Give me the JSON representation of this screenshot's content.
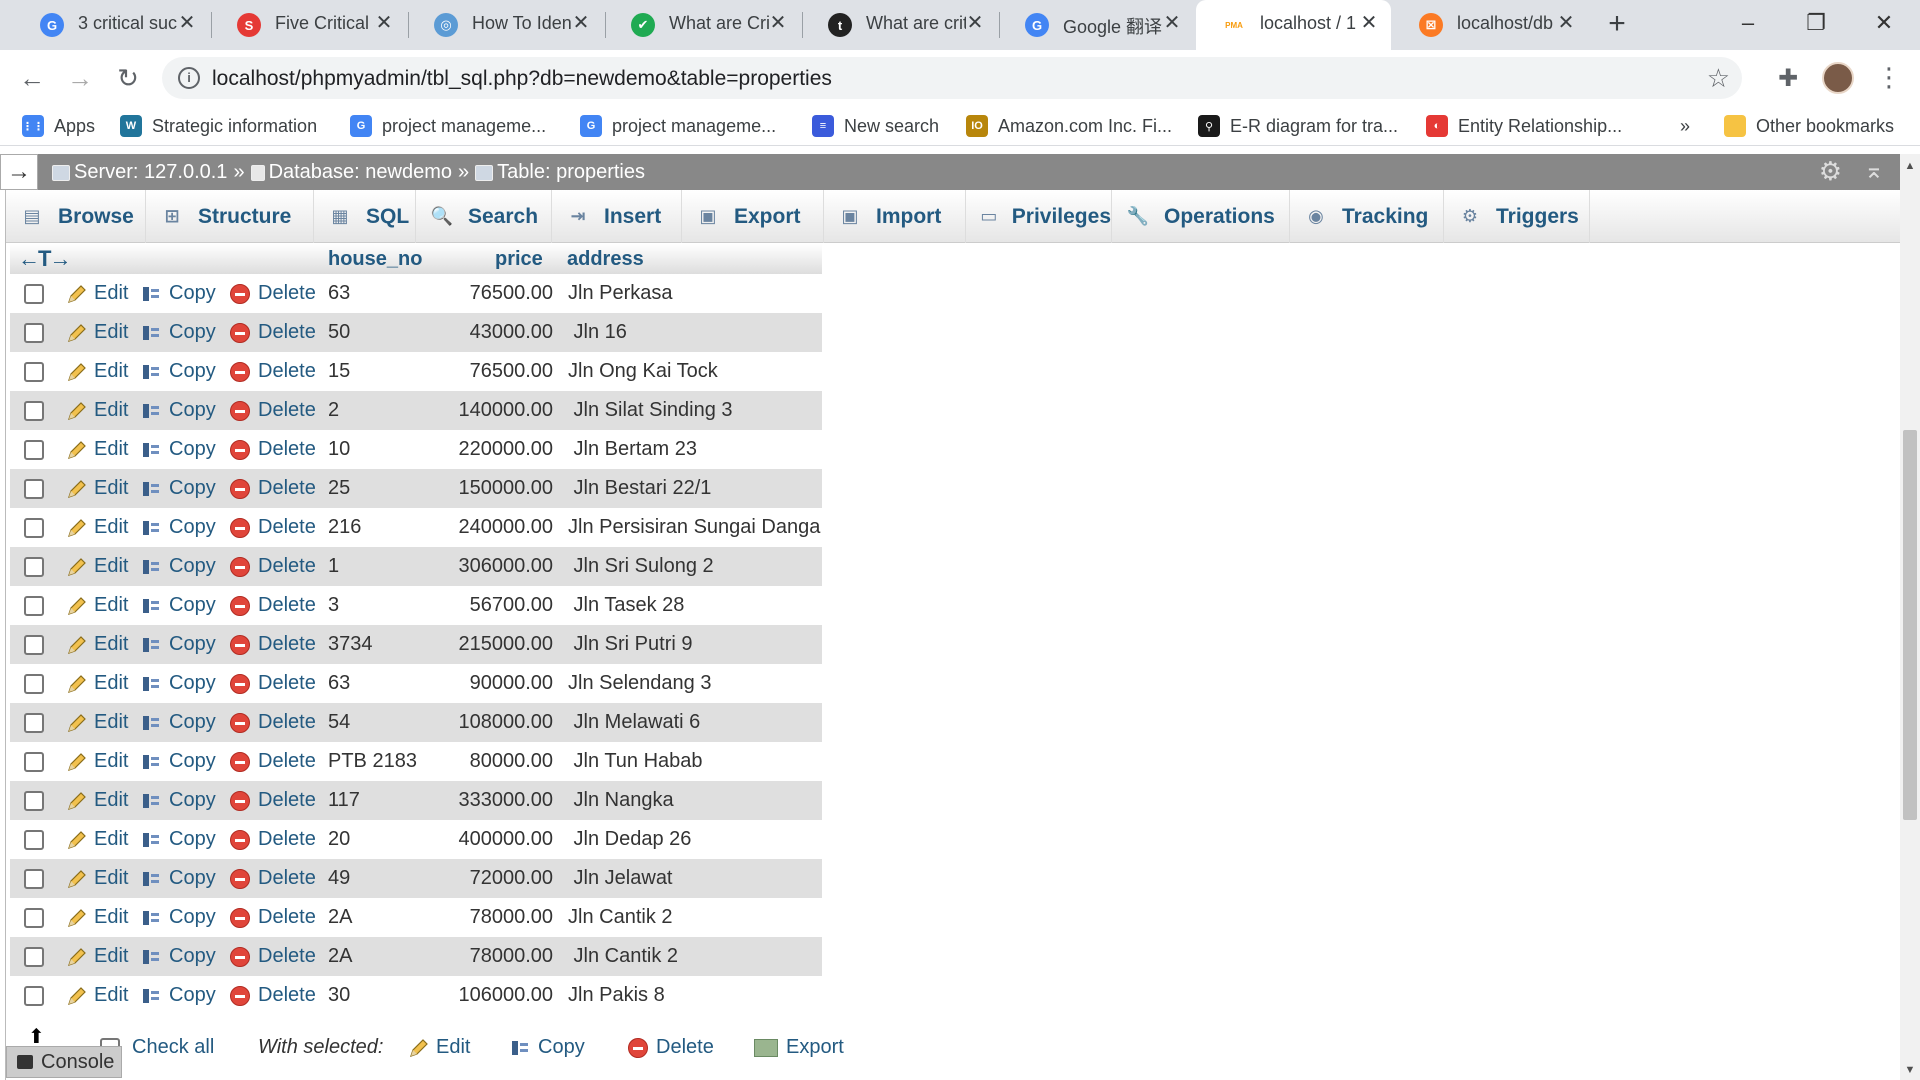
{
  "browser": {
    "tabs": [
      {
        "title": "3 critical suc",
        "favicon": "google-icon",
        "color": "#4285f4",
        "glyph": "G",
        "active": false
      },
      {
        "title": "Five Critical S",
        "favicon": "scribd-icon",
        "color": "#e53935",
        "glyph": "S",
        "active": false
      },
      {
        "title": "How To Iden",
        "favicon": "swirl-icon",
        "color": "#5b9bd5",
        "glyph": "◎",
        "active": false
      },
      {
        "title": "What are Cri",
        "favicon": "check-icon",
        "color": "#1faa52",
        "glyph": "✔",
        "active": false
      },
      {
        "title": "What are crit",
        "favicon": "t-icon",
        "color": "#222222",
        "glyph": "t",
        "active": false
      },
      {
        "title": "Google 翻译",
        "favicon": "translate-icon",
        "color": "#4285f4",
        "glyph": "G",
        "active": false
      },
      {
        "title": "localhost / 1",
        "favicon": "pma-icon",
        "color": "#f89c0e",
        "glyph": "PMA",
        "active": true
      },
      {
        "title": "localhost/db",
        "favicon": "xampp-icon",
        "color": "#fb7a24",
        "glyph": "⊠",
        "active": false
      }
    ],
    "url": "localhost/phpmyadmin/tbl_sql.php?db=newdemo&table=properties",
    "bookmarks": [
      {
        "label": "Apps",
        "icon": "apps-grid-icon",
        "color": "#4285f4",
        "glyph": "⋮⋮"
      },
      {
        "label": "Strategic information",
        "icon": "wordpress-icon",
        "color": "#21759b",
        "glyph": "W"
      },
      {
        "label": "project manageme...",
        "icon": "google-icon",
        "color": "#4285f4",
        "glyph": "G"
      },
      {
        "label": "project manageme...",
        "icon": "google-icon",
        "color": "#4285f4",
        "glyph": "G"
      },
      {
        "label": "New search",
        "icon": "search-lines-icon",
        "color": "#3b5bdb",
        "glyph": "≡"
      },
      {
        "label": "Amazon.com Inc. Fi...",
        "icon": "finance-icon",
        "color": "#b8860b",
        "glyph": "IO"
      },
      {
        "label": "E-R diagram for tra...",
        "icon": "er-icon",
        "color": "#1a1a1a",
        "glyph": "⚲"
      },
      {
        "label": "Entity Relationship...",
        "icon": "circle-red-icon",
        "color": "#e53935",
        "glyph": "◐"
      }
    ],
    "bookmarks_overflow": "»",
    "other_bookmarks": "Other bookmarks"
  },
  "pma": {
    "breadcrumb": {
      "server": "Server: 127.0.0.1",
      "database": "Database: newdemo",
      "table": "Table: properties",
      "separator": "»"
    },
    "menu": [
      {
        "label": "Browse",
        "icon": "browse-icon",
        "glyph": "▤"
      },
      {
        "label": "Structure",
        "icon": "structure-icon",
        "glyph": "⊞"
      },
      {
        "label": "SQL",
        "icon": "sql-icon",
        "glyph": "▦"
      },
      {
        "label": "Search",
        "icon": "search-icon",
        "glyph": "🔍"
      },
      {
        "label": "Insert",
        "icon": "insert-icon",
        "glyph": "⇥"
      },
      {
        "label": "Export",
        "icon": "export-icon",
        "glyph": "▣"
      },
      {
        "label": "Import",
        "icon": "import-icon",
        "glyph": "▣"
      },
      {
        "label": "Privileges",
        "icon": "privileges-icon",
        "glyph": "▭"
      },
      {
        "label": "Operations",
        "icon": "wrench-icon",
        "glyph": "🔧"
      },
      {
        "label": "Tracking",
        "icon": "eye-icon",
        "glyph": "◉"
      },
      {
        "label": "Triggers",
        "icon": "triggers-icon",
        "glyph": "⚙"
      }
    ],
    "table": {
      "sort_arrows": "←T→",
      "columns": [
        "house_no",
        "price",
        "address"
      ],
      "action_labels": {
        "edit": "Edit",
        "copy": "Copy",
        "delete": "Delete"
      },
      "rows": [
        {
          "house_no": "63",
          "price": "76500.00",
          "address": "Jln Perkasa"
        },
        {
          "house_no": "50",
          "price": "43000.00",
          "address": " Jln 16"
        },
        {
          "house_no": "15",
          "price": "76500.00",
          "address": "Jln Ong Kai Tock"
        },
        {
          "house_no": "2",
          "price": "140000.00",
          "address": " Jln Silat Sinding 3"
        },
        {
          "house_no": "10",
          "price": "220000.00",
          "address": " Jln Bertam 23"
        },
        {
          "house_no": "25",
          "price": "150000.00",
          "address": " Jln Bestari 22/1"
        },
        {
          "house_no": "216",
          "price": "240000.00",
          "address": "Jln Persisiran Sungai Danga"
        },
        {
          "house_no": "1",
          "price": "306000.00",
          "address": " Jln Sri Sulong 2"
        },
        {
          "house_no": "3",
          "price": "56700.00",
          "address": " Jln Tasek 28"
        },
        {
          "house_no": "3734",
          "price": "215000.00",
          "address": " Jln Sri Putri 9"
        },
        {
          "house_no": "63",
          "price": "90000.00",
          "address": "Jln Selendang 3"
        },
        {
          "house_no": "54",
          "price": "108000.00",
          "address": " Jln Melawati 6"
        },
        {
          "house_no": "PTB 2183",
          "price": "80000.00",
          "address": " Jln Tun Habab"
        },
        {
          "house_no": "117",
          "price": "333000.00",
          "address": " Jln Nangka"
        },
        {
          "house_no": "20",
          "price": "400000.00",
          "address": " Jln Dedap 26"
        },
        {
          "house_no": "49",
          "price": "72000.00",
          "address": " Jln Jelawat"
        },
        {
          "house_no": "2A",
          "price": "78000.00",
          "address": "Jln Cantik 2"
        },
        {
          "house_no": "2A",
          "price": "78000.00",
          "address": " Jln Cantik 2"
        },
        {
          "house_no": "30",
          "price": "106000.00",
          "address": "Jln Pakis 8"
        }
      ]
    },
    "footer": {
      "check_all": "Check all",
      "with_selected": "With selected:",
      "edit": "Edit",
      "copy": "Copy",
      "delete": "Delete",
      "export": "Export"
    },
    "console": "Console"
  }
}
